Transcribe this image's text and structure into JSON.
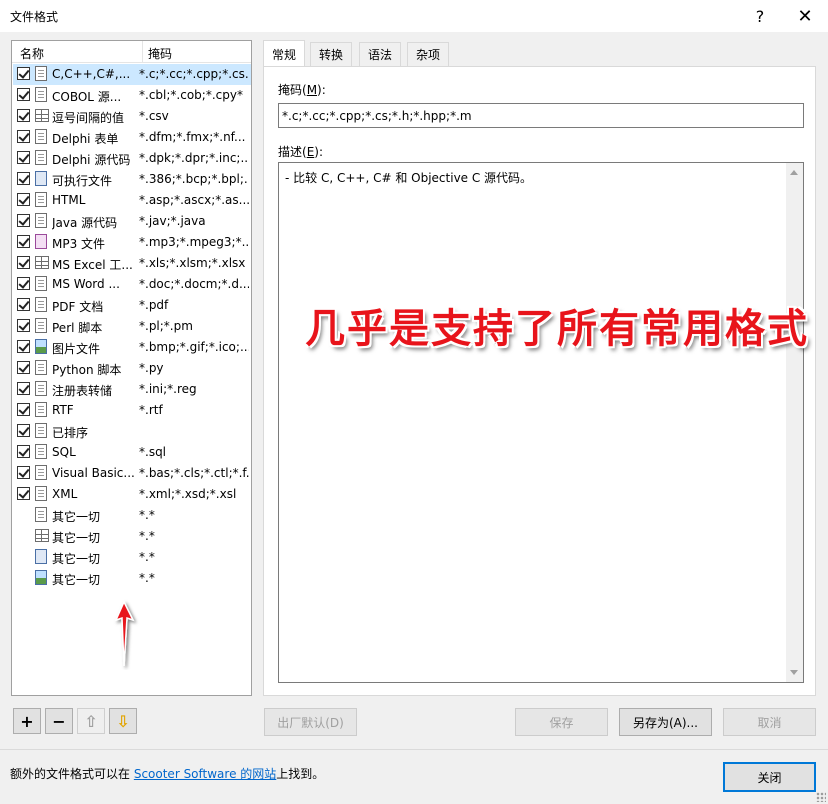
{
  "window": {
    "title": "文件格式",
    "help": "?",
    "close": "✕"
  },
  "list": {
    "headers": {
      "name": "名称",
      "mask": "掩码"
    },
    "rows": [
      {
        "name": "C,C++,C#,...",
        "mask": "*.c;*.cc;*.cpp;*.cs...",
        "checked": true,
        "icon": "file-lines",
        "selected": true
      },
      {
        "name": "COBOL 源...",
        "mask": "*.cbl;*.cob;*.cpy*",
        "checked": true,
        "icon": "file-lines"
      },
      {
        "name": "逗号间隔的值",
        "mask": "*.csv",
        "checked": true,
        "icon": "table-grid"
      },
      {
        "name": "Delphi 表单",
        "mask": "*.dfm;*.fmx;*.nf...",
        "checked": true,
        "icon": "file-lines"
      },
      {
        "name": "Delphi 源代码",
        "mask": "*.dpk;*.dpr;*.inc;...",
        "checked": true,
        "icon": "file-lines"
      },
      {
        "name": "可执行文件",
        "mask": "*.386;*.bcp;*.bpl;...",
        "checked": true,
        "icon": "executable"
      },
      {
        "name": "HTML",
        "mask": "*.asp;*.ascx;*.as...",
        "checked": true,
        "icon": "file-lines"
      },
      {
        "name": "Java 源代码",
        "mask": "*.jav;*.java",
        "checked": true,
        "icon": "file-lines"
      },
      {
        "name": "MP3 文件",
        "mask": "*.mp3;*.mpeg3;*...",
        "checked": true,
        "icon": "music"
      },
      {
        "name": "MS Excel 工...",
        "mask": "*.xls;*.xlsm;*.xlsx",
        "checked": true,
        "icon": "table-grid"
      },
      {
        "name": "MS Word ...",
        "mask": "*.doc;*.docm;*.d...",
        "checked": true,
        "icon": "file-lines"
      },
      {
        "name": "PDF 文档",
        "mask": "*.pdf",
        "checked": true,
        "icon": "file-lines"
      },
      {
        "name": "Perl 脚本",
        "mask": "*.pl;*.pm",
        "checked": true,
        "icon": "file-lines"
      },
      {
        "name": "图片文件",
        "mask": "*.bmp;*.gif;*.ico;...",
        "checked": true,
        "icon": "image"
      },
      {
        "name": "Python 脚本",
        "mask": "*.py",
        "checked": true,
        "icon": "file-lines"
      },
      {
        "name": "注册表转储",
        "mask": "*.ini;*.reg",
        "checked": true,
        "icon": "file-lines"
      },
      {
        "name": "RTF",
        "mask": "*.rtf",
        "checked": true,
        "icon": "file-lines"
      },
      {
        "name": "已排序",
        "mask": "",
        "checked": true,
        "icon": "file-lines"
      },
      {
        "name": "SQL",
        "mask": "*.sql",
        "checked": true,
        "icon": "file-lines"
      },
      {
        "name": "Visual Basic...",
        "mask": "*.bas;*.cls;*.ctl;*.f...",
        "checked": true,
        "icon": "file-lines"
      },
      {
        "name": "XML",
        "mask": "*.xml;*.xsd;*.xsl",
        "checked": true,
        "icon": "file-lines"
      },
      {
        "name": "其它一切",
        "mask": "*.*",
        "checked": false,
        "icon": "file-lines"
      },
      {
        "name": "其它一切",
        "mask": "*.*",
        "checked": false,
        "icon": "table-grid"
      },
      {
        "name": "其它一切",
        "mask": "*.*",
        "checked": false,
        "icon": "executable"
      },
      {
        "name": "其它一切",
        "mask": "*.*",
        "checked": false,
        "icon": "image"
      }
    ]
  },
  "list_buttons": {
    "add": "+",
    "remove": "−",
    "up": "⇧",
    "down": "⇩"
  },
  "tabs": [
    {
      "label": "常规",
      "active": true
    },
    {
      "label": "转换",
      "active": false
    },
    {
      "label": "语法",
      "active": false
    },
    {
      "label": "杂项",
      "active": false
    }
  ],
  "general": {
    "mask_label": "掩码(",
    "mask_key": "M",
    "mask_label_end": "):",
    "mask_value": "*.c;*.cc;*.cpp;*.cs;*.h;*.hpp;*.m",
    "desc_label": "描述(",
    "desc_key": "E",
    "desc_label_end": "):",
    "desc_value": "- 比较 C, C++, C# 和 Objective C 源代码。"
  },
  "overlay_text": "几乎是支持了所有常用格式",
  "buttons": {
    "factory_default": "出厂默认(D)",
    "save": "保存",
    "save_as": "另存为(A)...",
    "cancel": "取消",
    "close": "关闭"
  },
  "footer": {
    "prefix": "额外的文件格式可以在 ",
    "link": "Scooter Software 的网站",
    "suffix": "上找到。"
  },
  "colors": {
    "selection": "#cce8ff",
    "overlay": "#e8141b",
    "link": "#0066cc",
    "default_button_border": "#0078d7"
  }
}
